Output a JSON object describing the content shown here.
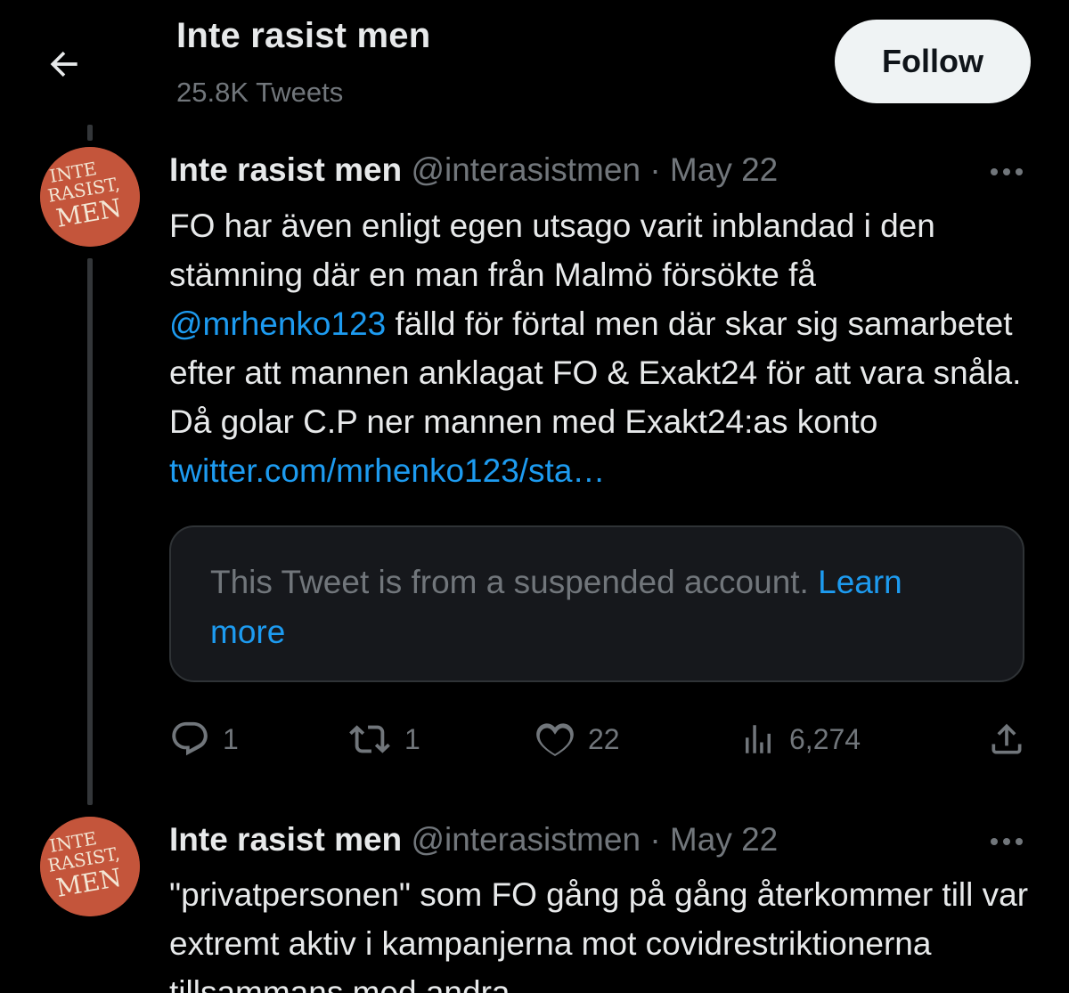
{
  "header": {
    "title": "Inte rasist men",
    "tweet_count": "25.8K Tweets",
    "follow_label": "Follow"
  },
  "avatar_text": [
    "INTE",
    "RASIST,",
    "MEN"
  ],
  "tweets": [
    {
      "name": "Inte rasist men",
      "handle": "@interasistmen",
      "dot": "·",
      "date": "May 22",
      "text_1": "FO har även enligt egen utsago varit inblandad i den stämning där en man från Malmö försökte få ",
      "mention": "@mrhenko123",
      "text_2": " fälld för förtal men där skar sig samarbetet efter att mannen anklagat FO & Exakt24 för att vara snåla. Då golar C.P ner mannen med Exakt24:as konto ",
      "url": "twitter.com/mrhenko123/sta…",
      "quote_text": "This Tweet is from a suspended account. ",
      "quote_link": "Learn more",
      "replies": "1",
      "retweets": "1",
      "likes": "22",
      "views": "6,274"
    },
    {
      "name": "Inte rasist men",
      "handle": "@interasistmen",
      "dot": "·",
      "date": "May 22",
      "text": "\"privatpersonen\" som FO gång på gång återkommer till var extremt aktiv i kampanjerna mot covidrestriktionerna tillsammans med andra"
    }
  ],
  "colors": {
    "background": "#000000",
    "text": "#e7e9ea",
    "secondary": "#71767b",
    "link": "#1d9bf0",
    "avatar": "#c4553b"
  },
  "icons": [
    "back-arrow-icon",
    "more-icon",
    "reply-icon",
    "retweet-icon",
    "like-icon",
    "views-icon",
    "share-icon"
  ]
}
